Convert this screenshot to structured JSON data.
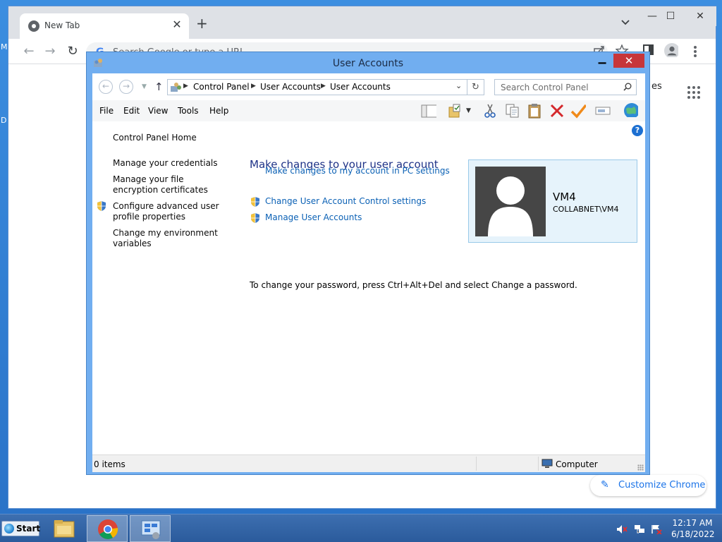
{
  "desktop": {
    "edge_letter_1": "M",
    "edge_letter_2": "D"
  },
  "chrome": {
    "tab_title": "New Tab",
    "tab_close": "✕",
    "new_tab": "+",
    "omnibox_placeholder": "Search Google or type a URL",
    "ntp_partial_text": "es",
    "customize_label": "Customize Chrome",
    "win_min": "—",
    "win_max": "☐",
    "win_close": "✕"
  },
  "ua_window": {
    "title": "User Accounts",
    "breadcrumbs": [
      "Control Panel",
      "User Accounts",
      "User Accounts"
    ],
    "search_placeholder": "Search Control Panel",
    "menu": [
      "File",
      "Edit",
      "View",
      "Tools",
      "Help"
    ],
    "help_icon": "?",
    "close_glyph": "✕",
    "min_glyph": "▁",
    "sidebar": {
      "home": "Control Panel Home",
      "items": [
        {
          "label": "Manage your credentials"
        },
        {
          "label": "Manage your file encryption certificates"
        },
        {
          "label": "Configure advanced user profile properties"
        },
        {
          "label": "Change my environment variables"
        }
      ]
    },
    "main": {
      "heading": "Make changes to your user account",
      "link_pc_settings": "Make changes to my account in PC settings",
      "link_uac": "Change User Account Control settings",
      "link_manage": "Manage User Accounts",
      "password_note": "To change your password, press Ctrl+Alt+Del and select Change a password."
    },
    "user": {
      "name": "VM4",
      "domain": "COLLABNET\\VM4"
    },
    "status": {
      "items": "0 items",
      "location": "Computer"
    }
  },
  "taskbar": {
    "start_label": "Start",
    "clock_time": "12:17 AM",
    "clock_date": "6/18/2022"
  },
  "colors": {
    "link": "#0b61b5",
    "heading": "#1e3287",
    "ua_frame": "#71aef0",
    "close_red": "#c7363a",
    "taskbar": "#2b5b9c"
  }
}
